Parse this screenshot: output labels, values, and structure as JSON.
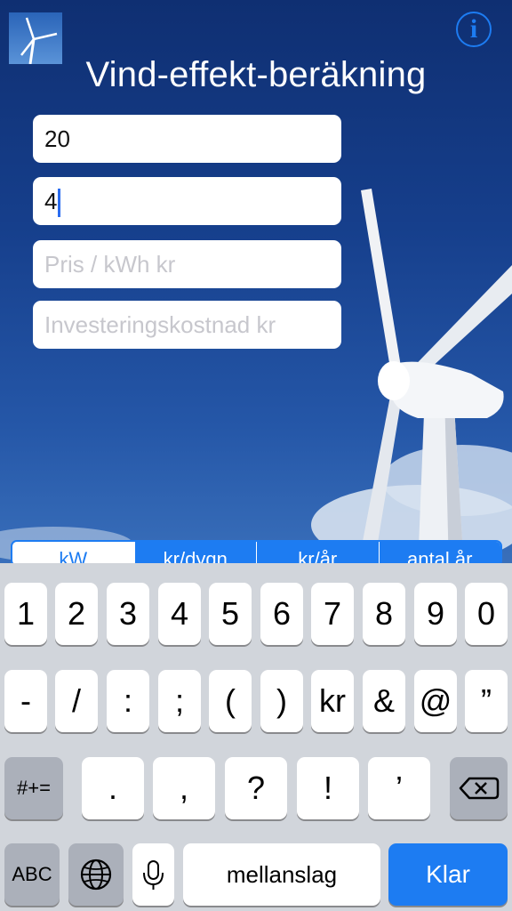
{
  "header": {
    "title": "Vind-effekt-beräkning",
    "info_icon": "info-icon",
    "app_icon": "wind-turbine-icon"
  },
  "form": {
    "field1_value": "20",
    "field2_value": "4",
    "field3_placeholder": "Pris / kWh   kr",
    "field4_placeholder": "Investeringskostnad kr"
  },
  "segments": [
    "kW",
    "kr/dygn",
    "kr/år",
    "antal år"
  ],
  "keyboard": {
    "row1": [
      "1",
      "2",
      "3",
      "4",
      "5",
      "6",
      "7",
      "8",
      "9",
      "0"
    ],
    "row2": [
      "-",
      "/",
      ":",
      ";",
      "(",
      ")",
      "kr",
      "&",
      "@",
      "”"
    ],
    "more_symbols": "#+=",
    "row3": [
      ".",
      ",",
      "?",
      "!",
      "’"
    ],
    "backspace_icon": "backspace-icon",
    "abc": "ABC",
    "globe_icon": "globe-icon",
    "mic_icon": "microphone-icon",
    "space": "mellanslag",
    "done": "Klar"
  },
  "colors": {
    "accent": "#1d7cf2",
    "keyboard_bg": "#d1d5db"
  }
}
